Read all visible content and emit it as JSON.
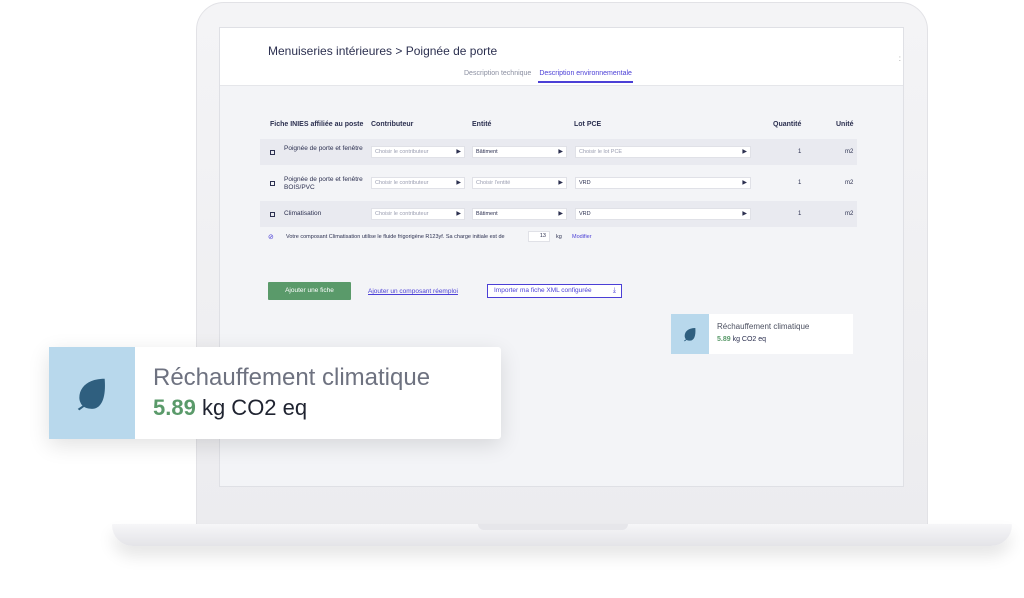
{
  "header": {
    "title": "Menuiseries intérieures > Poignée de porte",
    "tabs": [
      {
        "label": "Description technique",
        "active": false
      },
      {
        "label": "Description environnementale",
        "active": true
      }
    ]
  },
  "table": {
    "columns": {
      "fiche": "Fiche INIES affiliée au poste",
      "contributeur": "Contributeur",
      "entite": "Entité",
      "lot": "Lot PCE",
      "quantite": "Quantité",
      "unite": "Unité"
    },
    "rows": [
      {
        "label": "Poignée de porte et fenêtre",
        "contributeur": "Choisir le contributeur",
        "entite": "Bâtiment",
        "lot": "Choisir le lot PCE",
        "quantite": "1",
        "unite": "m2"
      },
      {
        "label": "Poignée de porte et fenêtre BOIS/PVC",
        "contributeur": "Choisir le contributeur",
        "entite": "Choisir l'entité",
        "lot": "VRD",
        "quantite": "1",
        "unite": "m2"
      },
      {
        "label": "Climatisation",
        "contributeur": "Choisir le contributeur",
        "entite": "Bâtiment",
        "lot": "VRD",
        "quantite": "1",
        "unite": "m2"
      }
    ]
  },
  "note": {
    "text": "Votre composant Climatisation utilise le fluide frigorigène R123yf. Sa charge initiale est de",
    "value": "13",
    "unit": "kg",
    "link": "Modifier"
  },
  "actions": {
    "add": "Ajouter une fiche",
    "reuse": "Ajouter un composant réemploi",
    "import": "Importer ma fiche XML configurée"
  },
  "impact": {
    "title": "Réchauffement climatique",
    "value": "5.89",
    "unit": "kg CO2 eq",
    "accent_color": "#5a9a6a",
    "icon": "leaf-icon"
  },
  "colors": {
    "primary": "#4b3fd6",
    "button_green": "#5a9a6a",
    "icon_bg": "#b8d8ec",
    "icon_fill": "#2f5f7f"
  }
}
